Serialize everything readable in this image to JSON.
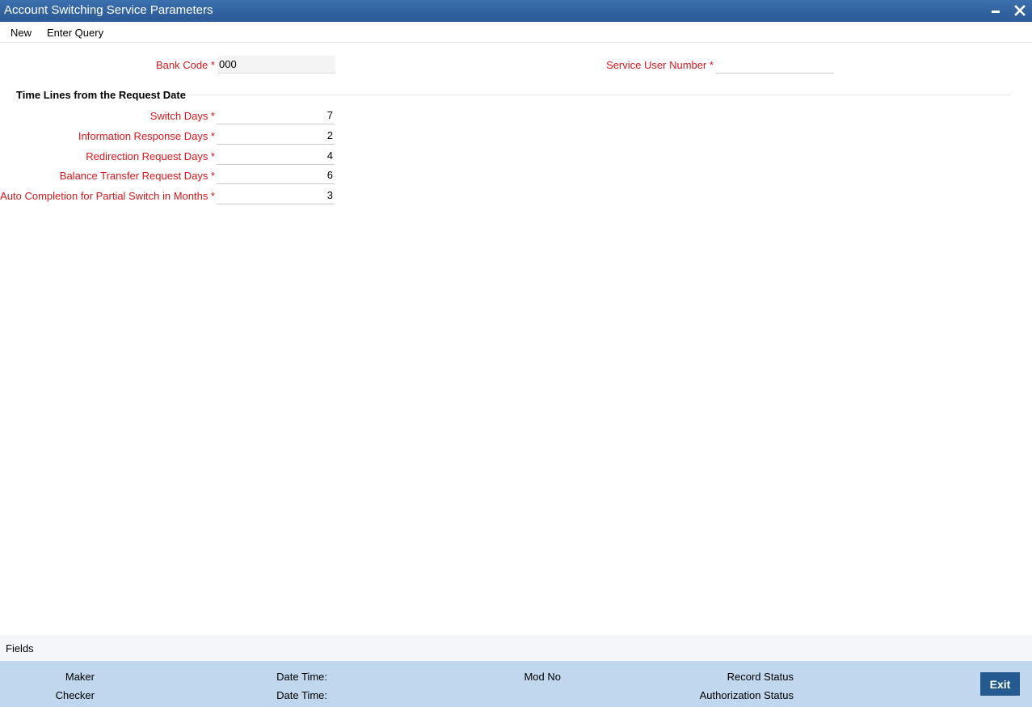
{
  "window": {
    "title": "Account Switching Service Parameters",
    "minimize_icon": "minimize-icon",
    "close_icon": "close-icon"
  },
  "toolbar": {
    "new_label": "New",
    "enter_query_label": "Enter Query"
  },
  "form": {
    "bank_code": {
      "label": "Bank Code *",
      "value": "000"
    },
    "service_user_number": {
      "label": "Service User Number *",
      "value": ""
    },
    "section_title": "Time Lines from the Request Date",
    "switch_days": {
      "label": "Switch Days *",
      "value": "7"
    },
    "information_response_days": {
      "label": "Information Response Days *",
      "value": "2"
    },
    "redirection_request_days": {
      "label": "Redirection Request Days *",
      "value": "4"
    },
    "balance_transfer_request_days": {
      "label": "Balance Transfer Request Days *",
      "value": "6"
    },
    "auto_completion_months": {
      "label": "Auto Completion for Partial Switch in Months *",
      "value": "3"
    }
  },
  "fields_bar": {
    "label": "Fields"
  },
  "footer": {
    "maker": "Maker",
    "checker": "Checker",
    "date_time_1": "Date Time:",
    "date_time_2": "Date Time:",
    "mod_no": "Mod No",
    "record_status": "Record Status",
    "authorization_status": "Authorization Status",
    "exit_label": "Exit"
  },
  "colors": {
    "titlebar": "#2a5a96",
    "required_label": "#d9161b",
    "footer_bg": "#c0d7ee",
    "exit_button": "#235a8f"
  }
}
